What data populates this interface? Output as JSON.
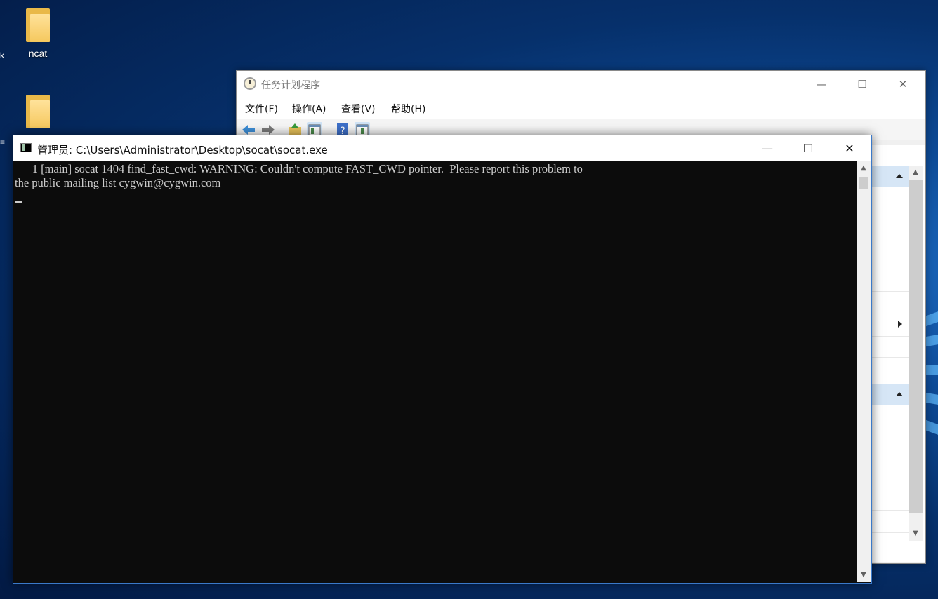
{
  "desktop": {
    "icons": [
      {
        "label": "ncat"
      },
      {
        "label": ""
      }
    ]
  },
  "task_scheduler": {
    "title": "任务计划程序",
    "menu": [
      "文件(F)",
      "操作(A)",
      "查看(V)",
      "帮助(H)"
    ],
    "controls": {
      "minimize": "—",
      "maximize": "☐",
      "close": "✕"
    }
  },
  "console": {
    "title": "管理员: C:\\Users\\Administrator\\Desktop\\socat\\socat.exe",
    "lines": [
      "      1 [main] socat 1404 find_fast_cwd: WARNING: Couldn't compute FAST_CWD pointer.  Please report this problem to",
      "the public mailing list cygwin@cygwin.com"
    ],
    "controls": {
      "minimize": "—",
      "maximize": "☐",
      "close": "✕"
    },
    "colors": {
      "background": "#0c0c0c",
      "foreground": "#cccccc"
    }
  }
}
